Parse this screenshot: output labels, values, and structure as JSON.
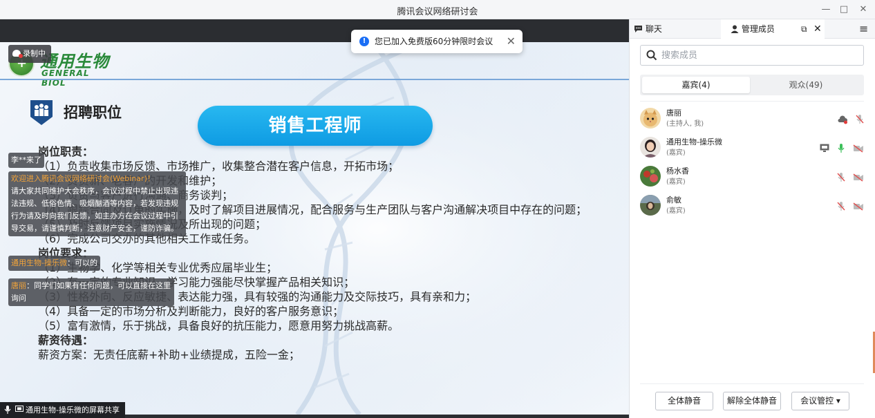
{
  "window": {
    "title": "腾讯会议网络研讨会",
    "minimize": "—",
    "maximize": "□",
    "close": "✕"
  },
  "slide": {
    "logo_cn": "通用生物",
    "logo_en": "GENERAL BIOL",
    "heading": "招聘职位",
    "position_title": "销售工程师",
    "lines": [
      {
        "text": "岗位职责：",
        "bold": true
      },
      {
        "text": "（1）负责收集市场反馈、市场推广，收集整合潜在客户信息，开拓市场；",
        "bold": false
      },
      {
        "text": "（2）负责新、老客户的开发和维护；",
        "bold": false
      },
      {
        "text": "（3）负责与客户进行沟通、商务谈判；",
        "bold": false
      },
      {
        "text": "（4）跟踪合同及订单的实施，及时了解项目进展情况，配合服务与生产团队与客户沟通解决项目中存在的问题；",
        "bold": false
      },
      {
        "text": "（5）及时反馈项目实施情况及所出现的问题；",
        "bold": false
      },
      {
        "text": "（6）完成公司交办的其他相关工作或任务。",
        "bold": false
      },
      {
        "text": "岗位要求：",
        "bold": true
      },
      {
        "text": "（1）生物学、化学等相关专业优秀应届毕业生；",
        "bold": false
      },
      {
        "text": "（2）有一定的专业知识，学习能力强能尽快掌握产品相关知识；",
        "bold": false
      },
      {
        "text": "（3）性格外向、反应敏捷、表达能力强，具有较强的沟通能力及交际技巧，具有亲和力；",
        "bold": false
      },
      {
        "text": "（4）具备一定的市场分析及判断能力，良好的客户服务意识；",
        "bold": false
      },
      {
        "text": "（5）富有激情，乐于挑战，具备良好的抗压能力，愿意用努力挑战高薪。",
        "bold": false
      },
      {
        "text": "薪资待遇：",
        "bold": true
      },
      {
        "text": "薪资方案：无责任底薪+补助+业绩提成，五险一金；",
        "bold": false
      }
    ]
  },
  "overlay": {
    "recording": "录制中",
    "toast": "您已加入免费版60分钟限时会议",
    "screen_share": "通用生物-操乐微的屏幕共享",
    "chat": [
      {
        "name": "",
        "text": "李**来了"
      },
      {
        "name": "欢迎进入腾讯会议网络研讨会(Webinar)！",
        "text": "请大家共同维护大会秩序，会议过程中禁止出现违法违规、低俗色情、吸烟酗酒等内容，若发现违规行为请及时向我们反馈，如主办方在会议过程中引导交易，请谨慎判断，注意财产安全，谨防诈骗。"
      },
      {
        "name": "通用生物-操乐微",
        "text": "：可以的"
      },
      {
        "name": "唐丽",
        "text": "：同学们如果有任何问题，可以直接在这里询问"
      }
    ]
  },
  "panel": {
    "tab_chat": "聊天",
    "tab_manage": "管理成员",
    "search_placeholder": "搜索成员",
    "seg_guests": "嘉宾(4)",
    "seg_audience": "观众(49)",
    "members": [
      {
        "name": "唐丽",
        "role": "(主持人, 我)",
        "avatar": "cat-avatar"
      },
      {
        "name": "通用生物-操乐微",
        "role": "(嘉宾)",
        "avatar": "woman-avatar"
      },
      {
        "name": "杨水香",
        "role": "(嘉宾)",
        "avatar": "flower-avatar"
      },
      {
        "name": "俞敏",
        "role": "(嘉宾)",
        "avatar": "landscape-avatar"
      }
    ],
    "btn_mute_all": "全体静音",
    "btn_unmute_all": "解除全体静音",
    "btn_control": "会议管控 ▾"
  },
  "colors": {
    "accent": "#1a6ef5",
    "pill": "#0e9be3",
    "logo_green": "#2a8a3a",
    "chat_name": "#f3a43a"
  }
}
